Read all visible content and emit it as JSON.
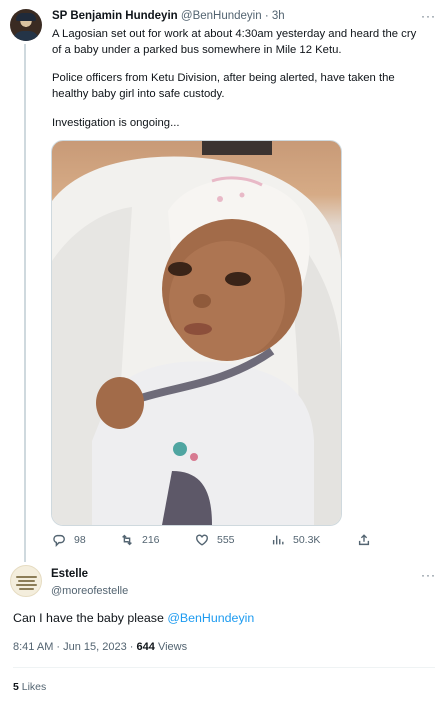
{
  "tweet": {
    "author_name": "SP Benjamin Hundeyin",
    "author_handle": "@BenHundeyin",
    "separator": "·",
    "time": "3h",
    "more": "···",
    "lines": [
      "A Lagosian set out for work at about 4:30am yesterday and heard the cry",
      "of a baby under a parked bus somewhere in Mile 12 Ketu.",
      "Police officers from Ketu Division, after being alerted, have taken the",
      "healthy baby girl into safe custody.",
      "Investigation is ongoing..."
    ],
    "metrics": {
      "replies": "98",
      "reposts": "216",
      "likes": "555",
      "views": "50.3K"
    }
  },
  "reply": {
    "author_name": "Estelle",
    "author_handle": "@moreofestelle",
    "more": "···",
    "text": "Can I have the baby please ",
    "mention": "@BenHundeyin",
    "timestamp": "8:41 AM · Jun 15, 2023 · ",
    "views_count": "644",
    "views_label": " Views",
    "likes_count": "5",
    "likes_label": " Likes"
  },
  "colors": {
    "link": "#1d9bf0",
    "text": "#0f1419",
    "secondary": "#536471",
    "border": "#cfd9de"
  },
  "icons": [
    "reply-icon",
    "repost-icon",
    "like-icon",
    "views-icon",
    "share-icon",
    "more-icon"
  ]
}
